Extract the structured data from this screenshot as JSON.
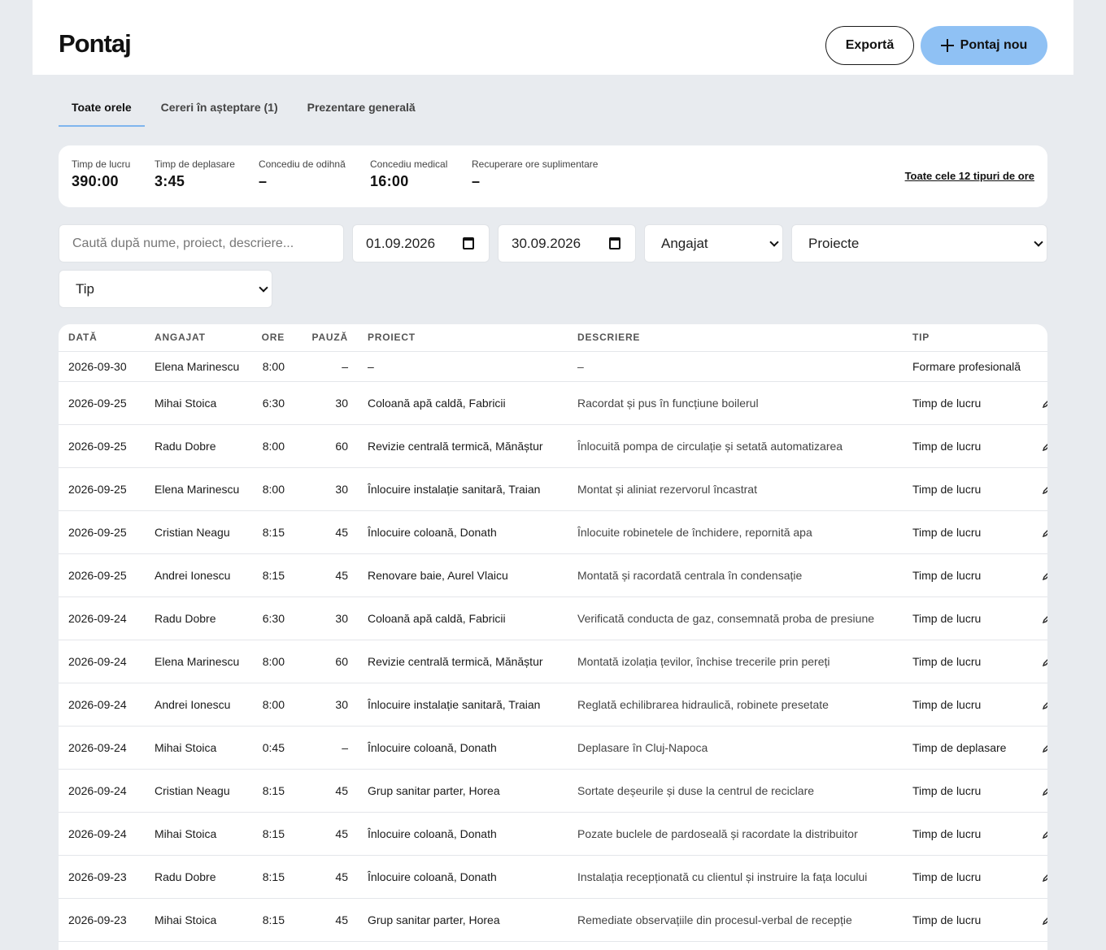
{
  "header": {
    "title": "Pontaj",
    "export_label": "Exportă",
    "new_label": "Pontaj nou"
  },
  "tabs": [
    {
      "label": "Toate orele",
      "active": true
    },
    {
      "label": "Cereri în așteptare (1)",
      "active": false
    },
    {
      "label": "Prezentare generală",
      "active": false
    }
  ],
  "summary": {
    "stats": [
      {
        "label": "Timp de lucru",
        "value": "390:00"
      },
      {
        "label": "Timp de deplasare",
        "value": "3:45"
      },
      {
        "label": "Concediu de odihnă",
        "value": "–"
      },
      {
        "label": "Concediu medical",
        "value": "16:00"
      },
      {
        "label": "Recuperare ore suplimentare",
        "value": "–"
      }
    ],
    "all_types_link": "Toate cele 12 tipuri de ore"
  },
  "filters": {
    "search_placeholder": "Caută după nume, proiect, descriere...",
    "date_from": "01.09.2026",
    "date_to": "30.09.2026",
    "employee_select": "Angajat",
    "projects_select": "Proiecte",
    "type_select": "Tip"
  },
  "table": {
    "columns": [
      "DATĂ",
      "ANGAJAT",
      "ORE",
      "PAUZĂ",
      "PROIECT",
      "DESCRIERE",
      "TIP"
    ],
    "rows": [
      [
        "2026-09-30",
        "Elena Marinescu",
        "8:00",
        "–",
        "–",
        "–",
        "Formare profesională"
      ],
      [
        "2026-09-25",
        "Mihai Stoica",
        "6:30",
        "30",
        "Coloană apă caldă, Fabricii",
        "Racordat și pus în funcțiune boilerul",
        "Timp de lucru"
      ],
      [
        "2026-09-25",
        "Radu Dobre",
        "8:00",
        "60",
        "Revizie centrală termică, Mănăștur",
        "Înlocuită pompa de circulație și setată automatizarea",
        "Timp de lucru"
      ],
      [
        "2026-09-25",
        "Elena Marinescu",
        "8:00",
        "30",
        "Înlocuire instalație sanitară, Traian",
        "Montat și aliniat rezervorul încastrat",
        "Timp de lucru"
      ],
      [
        "2026-09-25",
        "Cristian Neagu",
        "8:15",
        "45",
        "Înlocuire coloană, Donath",
        "Înlocuite robinetele de închidere, repornită apa",
        "Timp de lucru"
      ],
      [
        "2026-09-25",
        "Andrei Ionescu",
        "8:15",
        "45",
        "Renovare baie, Aurel Vlaicu",
        "Montată și racordată centrala în condensație",
        "Timp de lucru"
      ],
      [
        "2026-09-24",
        "Radu Dobre",
        "6:30",
        "30",
        "Coloană apă caldă, Fabricii",
        "Verificată conducta de gaz, consemnată proba de presiune",
        "Timp de lucru"
      ],
      [
        "2026-09-24",
        "Elena Marinescu",
        "8:00",
        "60",
        "Revizie centrală termică, Mănăștur",
        "Montată izolația țevilor, închise trecerile prin pereți",
        "Timp de lucru"
      ],
      [
        "2026-09-24",
        "Andrei Ionescu",
        "8:00",
        "30",
        "Înlocuire instalație sanitară, Traian",
        "Reglată echilibrarea hidraulică, robinete presetate",
        "Timp de lucru"
      ],
      [
        "2026-09-24",
        "Mihai Stoica",
        "0:45",
        "–",
        "Înlocuire coloană, Donath",
        "Deplasare în Cluj-Napoca",
        "Timp de deplasare"
      ],
      [
        "2026-09-24",
        "Cristian Neagu",
        "8:15",
        "45",
        "Grup sanitar parter, Horea",
        "Sortate deșeurile și duse la centrul de reciclare",
        "Timp de lucru"
      ],
      [
        "2026-09-24",
        "Mihai Stoica",
        "8:15",
        "45",
        "Înlocuire coloană, Donath",
        "Pozate buclele de pardoseală și racordate la distribuitor",
        "Timp de lucru"
      ],
      [
        "2026-09-23",
        "Radu Dobre",
        "8:15",
        "45",
        "Înlocuire coloană, Donath",
        "Instalația recepționată cu clientul și instruire la fața locului",
        "Timp de lucru"
      ],
      [
        "2026-09-23",
        "Mihai Stoica",
        "8:15",
        "45",
        "Grup sanitar parter, Horea",
        "Remediate observațiile din procesul-verbal de recepție",
        "Timp de lucru"
      ]
    ]
  }
}
